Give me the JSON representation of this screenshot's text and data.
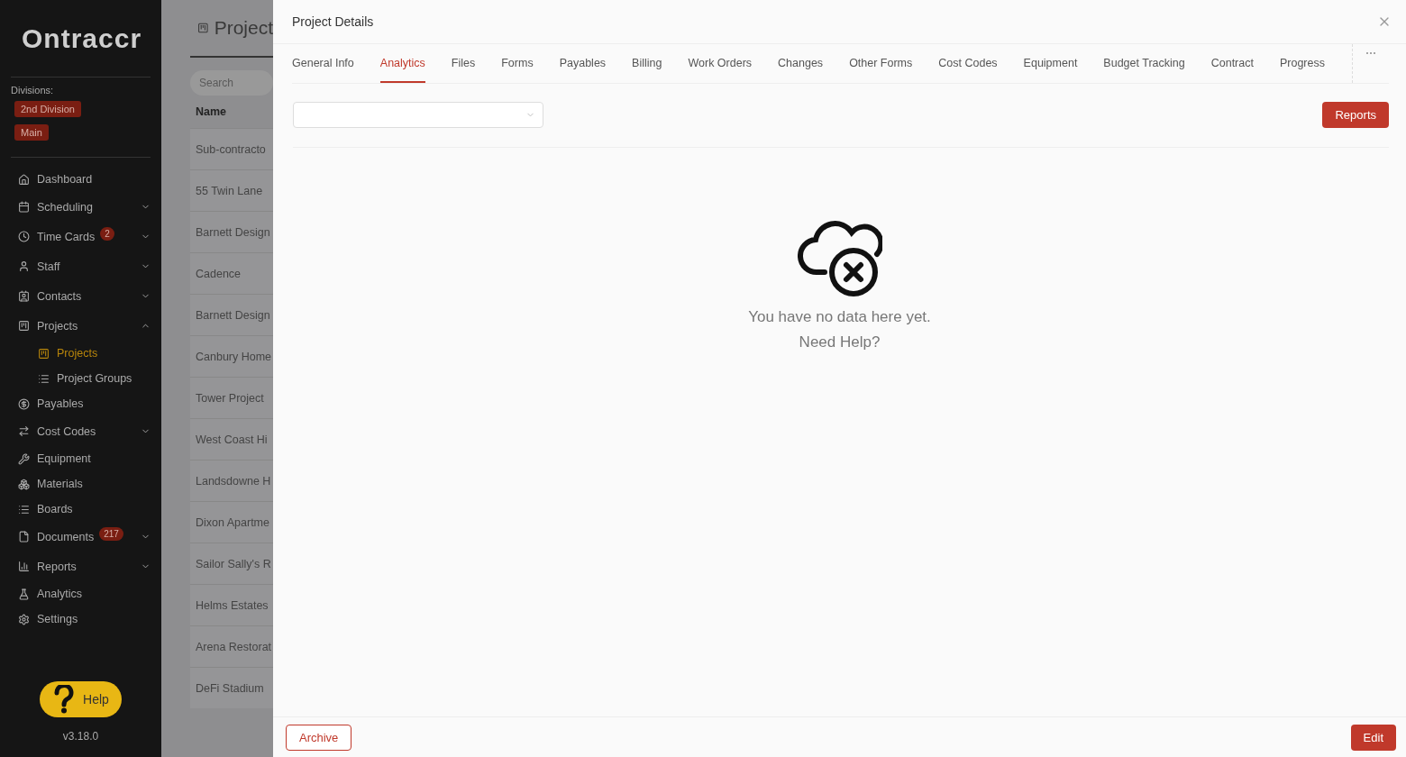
{
  "sidebar": {
    "logo": "Ontraccr",
    "divisions_label": "Divisions:",
    "divisions": [
      "2nd Division",
      "Main"
    ],
    "items": [
      {
        "kind": "home",
        "label": "Dashboard"
      },
      {
        "kind": "calendar",
        "label": "Scheduling",
        "expanded": false
      },
      {
        "kind": "clock",
        "label": "Time Cards",
        "badge": "2",
        "expanded": false
      },
      {
        "kind": "user",
        "label": "Staff",
        "expanded": false
      },
      {
        "kind": "contact",
        "label": "Contacts",
        "expanded": false
      },
      {
        "kind": "board",
        "label": "Projects",
        "expanded": true,
        "children": [
          {
            "kind": "board",
            "label": "Projects",
            "selected": true
          },
          {
            "kind": "list",
            "label": "Project Groups",
            "selected": false
          }
        ]
      },
      {
        "kind": "dollar",
        "label": "Payables"
      },
      {
        "kind": "arrows",
        "label": "Cost Codes",
        "expanded": false
      },
      {
        "kind": "wrench",
        "label": "Equipment"
      },
      {
        "kind": "boxes",
        "label": "Materials"
      },
      {
        "kind": "list",
        "label": "Boards"
      },
      {
        "kind": "file",
        "label": "Documents",
        "badge": "217",
        "expanded": false
      },
      {
        "kind": "chart",
        "label": "Reports",
        "expanded": false
      },
      {
        "kind": "flask",
        "label": "Analytics"
      },
      {
        "kind": "gear",
        "label": "Settings"
      }
    ],
    "help_button": "Help",
    "version": "v3.18.0"
  },
  "background_page": {
    "title": "Project",
    "search": {
      "placeholder": "Search"
    },
    "column": "Name",
    "rows": [
      "Sub-contracto",
      "55 Twin Lane",
      "Barnett Design",
      "Cadence",
      "Barnett Design",
      "Canbury Home",
      "Tower Project",
      "West Coast Hi",
      "Landsdowne H",
      "Dixon Apartme",
      "Sailor Sally's R",
      "Helms Estates",
      "Arena Restorat",
      "DeFi Stadium"
    ]
  },
  "drawer": {
    "title": "Project Details",
    "tabs": [
      {
        "label": "General Info",
        "selected": false
      },
      {
        "label": "Analytics",
        "selected": true
      },
      {
        "label": "Files",
        "selected": false
      },
      {
        "label": "Forms",
        "selected": false
      },
      {
        "label": "Payables",
        "selected": false
      },
      {
        "label": "Billing",
        "selected": false
      },
      {
        "label": "Work Orders",
        "selected": false
      },
      {
        "label": "Changes",
        "selected": false
      },
      {
        "label": "Other Forms",
        "selected": false
      },
      {
        "label": "Cost Codes",
        "selected": false
      },
      {
        "label": "Equipment",
        "selected": false
      },
      {
        "label": "Budget Tracking",
        "selected": false
      },
      {
        "label": "Contract",
        "selected": false
      },
      {
        "label": "Progress",
        "selected": false
      }
    ],
    "reports_button": "Reports",
    "empty_state": {
      "message": "You have no data here yet.",
      "help_link": "Need Help?"
    },
    "footer": {
      "archive_button": "Archive",
      "edit_button": "Edit"
    }
  }
}
